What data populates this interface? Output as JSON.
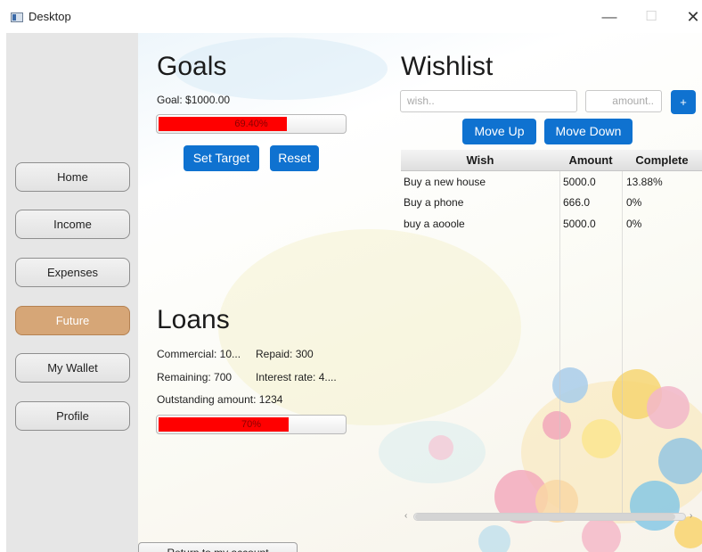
{
  "window": {
    "title": "Desktop",
    "icon": "app-window-icon",
    "minimize_glyph": "—",
    "maximize_glyph": "☐",
    "close_glyph": "✕"
  },
  "sidebar": {
    "items": [
      {
        "label": "Home",
        "active": false
      },
      {
        "label": "Income",
        "active": false
      },
      {
        "label": "Expenses",
        "active": false
      },
      {
        "label": "Future",
        "active": true
      },
      {
        "label": "My Wallet",
        "active": false
      },
      {
        "label": "Profile",
        "active": false
      }
    ]
  },
  "goals": {
    "heading": "Goals",
    "goal_text": "Goal: $1000.00",
    "progress_text": "69.40%",
    "progress_value": 0.694,
    "set_target_label": "Set Target",
    "reset_label": "Reset"
  },
  "wishlist": {
    "heading": "Wishlist",
    "wish_placeholder": "wish..",
    "amount_placeholder": "amount..",
    "add_label": "+",
    "move_up_label": "Move Up",
    "move_down_label": "Move Down",
    "columns": [
      "Wish",
      "Amount",
      "Complete"
    ],
    "rows": [
      {
        "wish": "Buy a new house",
        "amount": "5000.0",
        "complete": "13.88%"
      },
      {
        "wish": "Buy a phone",
        "amount": "666.0",
        "complete": "0%"
      },
      {
        "wish": "buy a aooole",
        "amount": "5000.0",
        "complete": "0%"
      }
    ]
  },
  "loans": {
    "heading": "Loans",
    "commercial": "Commercial: 10...",
    "repaid": "Repaid: 300",
    "remaining": "Remaining: 700",
    "interest": "Interest rate: 4....",
    "outstanding": "Outstanding amount: 1234",
    "progress_text": "70%",
    "progress_value": 0.7
  },
  "footer": {
    "return_label": "Return to my account"
  },
  "colors": {
    "accent": "#0f72d0",
    "active_nav": "#d6a677",
    "progress_fill": "#ff0000"
  }
}
